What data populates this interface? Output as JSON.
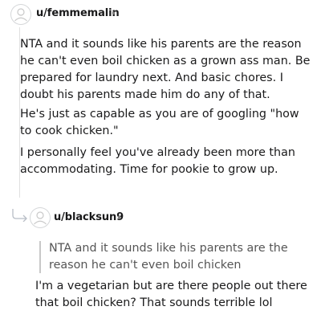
{
  "comment1": {
    "username": "u/femmemalin",
    "separator": "•",
    "avatar_icon": "default-avatar-icon",
    "paragraphs": [
      "NTA and it sounds like his parents are the reason he can't even boil chicken as a grown ass man. Be prepared for laundry next. And basic chores. I doubt his parents made him do any of that.",
      "He's just as capable as you are of googling \"how to cook chicken.\"",
      "I personally feel you've already been more than accommodating. Time for pookie to grow up."
    ]
  },
  "comment2": {
    "username": "u/blacksun9",
    "separator": "•",
    "avatar_icon": "default-avatar-icon",
    "reply_icon": "reply-arrow-icon",
    "quote": "NTA and it sounds like his parents are the reason he can't even boil chicken",
    "body": "I'm a vegetarian but are there people out there that boil chicken? That sounds terrible lol"
  }
}
